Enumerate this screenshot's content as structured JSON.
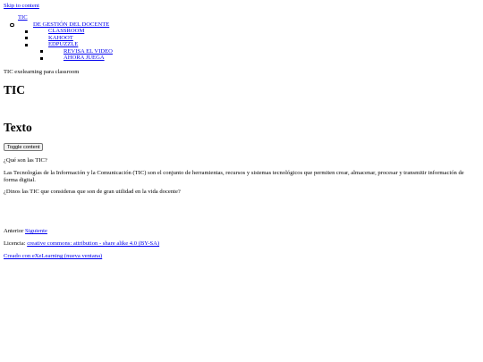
{
  "skip_link": "Skip to content",
  "nav": {
    "root": "TIC",
    "sub": "DE GESTIÓN DEL DOCENTE",
    "items": [
      "CLASSROOM",
      "KAHOOT",
      "EDPUZZLE"
    ],
    "edpuzzle_children": [
      "REVISA EL VIDEO",
      "AHORA JUEGA"
    ]
  },
  "site_tagline": "TIC exelearning para classroom",
  "page_title": "TIC",
  "section_title": "Texto",
  "toggle_button": "Toggle content",
  "content": {
    "question": "¿Qué son las TIC?",
    "paragraph": "Las Tecnologías de la Información y la Comunicación (TIC) son el conjunto de herramientas, recursos y sistemas tecnológicos que permiten crear, almacenar, procesar y transmitir información de forma digital.",
    "prompt": "¿Dinos las TIC que consideras que son de gran utilidad en la vida docente?"
  },
  "pagination": {
    "prev": "Anterior",
    "next": "Siguiente"
  },
  "license": {
    "label": "Licencia:",
    "link": "creative commons: attribution - share alike 4.0 (BY-SA)"
  },
  "credit": "Creado con eXeLearning (nueva ventana)"
}
